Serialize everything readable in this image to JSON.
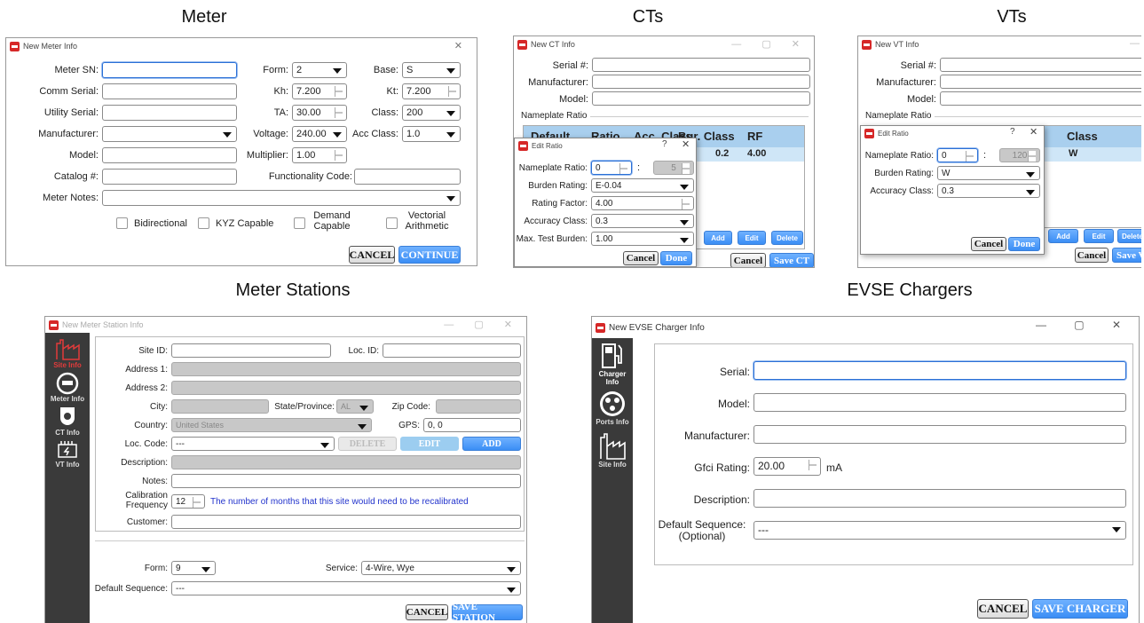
{
  "captions": {
    "meter": "Meter",
    "cts": "CTs",
    "vts": "VTs",
    "stations": "Meter Stations",
    "evse": "EVSE Chargers"
  },
  "colors": {
    "accent": "#3b8ef5",
    "brand": "#d62828",
    "sidebar": "#3a3a3a",
    "disabled": "#c8c8c8"
  },
  "meter": {
    "title": "New Meter Info",
    "labels": {
      "sn": "Meter SN:",
      "comm": "Comm Serial:",
      "utility": "Utility Serial:",
      "manufacturer": "Manufacturer:",
      "model": "Model:",
      "catalog": "Catalog #:",
      "notes": "Meter Notes:",
      "form": "Form:",
      "kh": "Kh:",
      "ta": "TA:",
      "voltage": "Voltage:",
      "multiplier": "Multiplier:",
      "base": "Base:",
      "kt": "Kt:",
      "class": "Class:",
      "acc": "Acc Class:",
      "func": "Functionality Code:"
    },
    "values": {
      "form": "2",
      "kh": "7.200",
      "ta": "30.00",
      "voltage": "240.00",
      "multiplier": "1.00",
      "base": "S",
      "kt": "7.200",
      "class": "200",
      "acc": "1.0"
    },
    "checks": {
      "bi": "Bidirectional",
      "kyz": "KYZ Capable",
      "demand1": "Demand",
      "demand2": "Capable",
      "vect1": "Vectorial",
      "vect2": "Arithmetic"
    },
    "cancel": "CANCEL",
    "continue": "CONTINUE"
  },
  "ct": {
    "title": "New CT Info",
    "labels": {
      "serial": "Serial #:",
      "manufacturer": "Manufacturer:",
      "model": "Model:"
    },
    "nameplate": "Nameplate Ratio",
    "table": {
      "headers": [
        "Default",
        "Ratio",
        "Acc. Class",
        "Bur. Class",
        "RF"
      ],
      "row": [
        "0.2",
        "4.00"
      ]
    },
    "add": "Add",
    "edit": "Edit",
    "delete": "Delete",
    "cancel": "Cancel",
    "save": "Save CT",
    "dlg": {
      "title": "Edit Ratio",
      "q": "?",
      "labels": {
        "ratio": "Nameplate Ratio:",
        "burden": "Burden Rating:",
        "rf": "Rating Factor:",
        "acc": "Accuracy Class:",
        "max": "Max. Test Burden:"
      },
      "values": {
        "ratio": "0",
        "ratio2": "5",
        "burden": "E-0.04",
        "rf": "4.00",
        "acc": "0.3",
        "max": "1.00"
      },
      "cancel": "Cancel",
      "done": "Done"
    }
  },
  "vt": {
    "title": "New VT Info",
    "labels": {
      "serial": "Serial #:",
      "manufacturer": "Manufacturer:",
      "model": "Model:"
    },
    "nameplate": "Nameplate Ratio",
    "header_frag": "Class",
    "row_frag": "W",
    "add": "Add",
    "edit": "Edit",
    "delete": "Delete",
    "cancel": "Cancel",
    "save": "Save V",
    "dlg": {
      "title": "Edit Ratio",
      "q": "?",
      "labels": {
        "ratio": "Nameplate Ratio:",
        "burden": "Burden Rating:",
        "acc": "Accuracy Class:"
      },
      "values": {
        "ratio": "0",
        "ratio2": "120",
        "burden": "W",
        "acc": "0.3"
      },
      "cancel": "Cancel",
      "done": "Done"
    }
  },
  "station": {
    "title": "New Meter Station Info",
    "side": {
      "site": "Site Info",
      "meter": "Meter Info",
      "ct": "CT Info",
      "vt": "VT Info"
    },
    "labels": {
      "site": "Site ID:",
      "loc": "Loc. ID:",
      "addr1": "Address 1:",
      "addr2": "Address 2:",
      "city": "City:",
      "state": "State/Province:",
      "zip": "Zip Code:",
      "country": "Country:",
      "gps": "GPS:",
      "loccode": "Loc. Code:",
      "desc": "Description:",
      "notes": "Notes:",
      "cal1": "Calibration",
      "cal2": "Frequency",
      "customer": "Customer:",
      "form": "Form:",
      "service": "Service:",
      "seq": "Default Sequence:"
    },
    "values": {
      "state": "AL",
      "country": "United States",
      "gps": "0, 0",
      "loccode": "---",
      "cal": "12",
      "form": "9",
      "service": "4-Wire, Wye",
      "seq": "---"
    },
    "cal_hint": "The number of months that this site would need to be recalibrated",
    "delete": "DELETE",
    "edit": "EDIT",
    "add": "ADD",
    "cancel": "CANCEL",
    "save": "SAVE STATION"
  },
  "evse": {
    "title": "New EVSE Charger Info",
    "side": {
      "charger1": "Charger",
      "charger2": "Info",
      "ports": "Ports Info",
      "site": "Site Info"
    },
    "labels": {
      "serial": "Serial:",
      "model": "Model:",
      "manufacturer": "Manufacturer:",
      "gfci": "Gfci Rating:",
      "desc": "Description:",
      "seq1": "Default Sequence:",
      "seq2": "(Optional)"
    },
    "values": {
      "gfci": "20.00",
      "unit": "mA",
      "seq": "---"
    },
    "cancel": "CANCEL",
    "save": "SAVE CHARGER"
  }
}
